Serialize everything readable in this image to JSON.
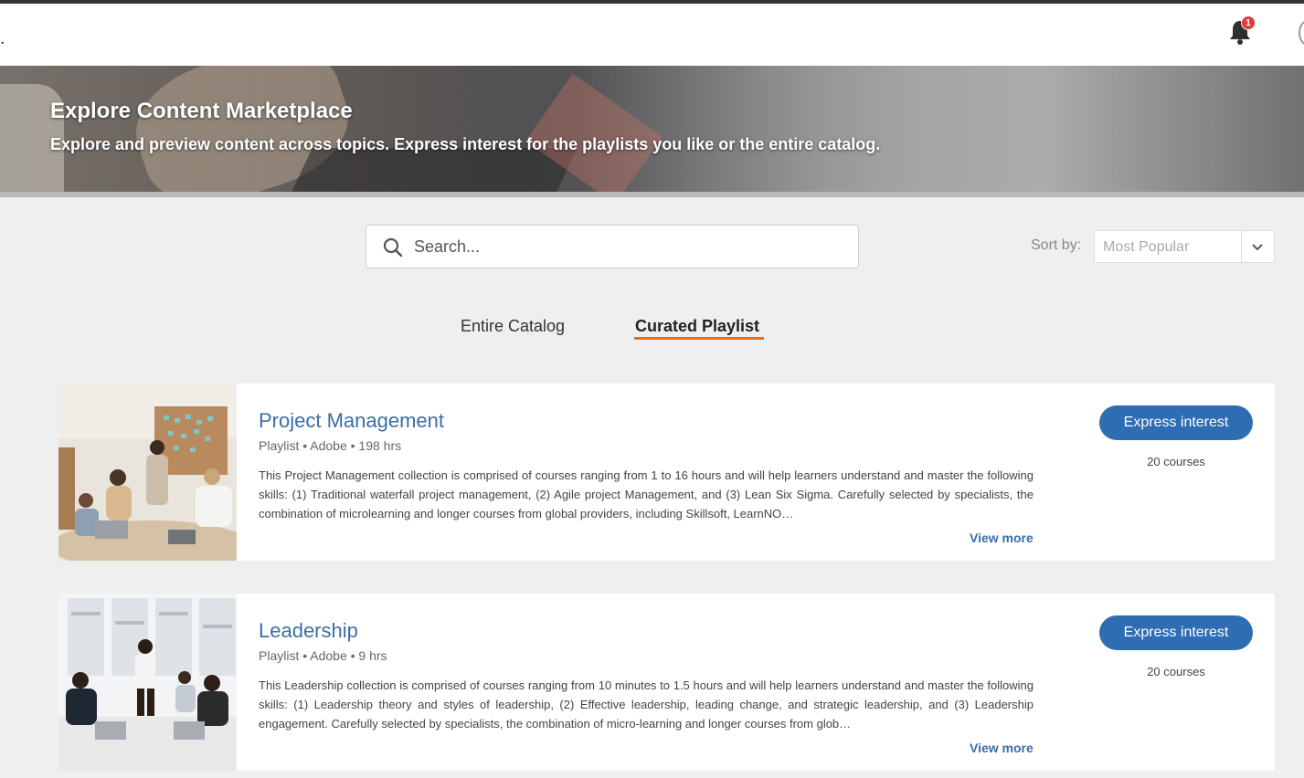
{
  "header": {
    "notification_count": "1",
    "leading_char": "."
  },
  "banner": {
    "title": "Explore Content Marketplace",
    "subtitle": "Explore and preview content across topics. Express interest for the playlists you like or the entire catalog."
  },
  "search": {
    "placeholder": "Search..."
  },
  "sort": {
    "label": "Sort by:",
    "value": "Most Popular"
  },
  "tabs": [
    {
      "label": "Entire Catalog",
      "active": false
    },
    {
      "label": "Curated Playlist",
      "active": true
    }
  ],
  "colors": {
    "accent_blue": "#2e6db4",
    "tab_underline": "#e86a1a",
    "badge": "#e53935"
  },
  "playlists": [
    {
      "title": "Project Management",
      "meta": "Playlist • Adobe • 198 hrs",
      "description": "This Project Management collection is comprised of courses ranging from 1 to 16 hours and will help learners understand and master the following skills: (1) Traditional waterfall project management, (2) Agile project Management, and (3) Lean Six Sigma. Carefully selected by specialists, the combination of microlearning and longer courses from global providers, including Skillsoft, LearnNO…",
      "view_more": "View more",
      "button": "Express interest",
      "courses": "20 courses"
    },
    {
      "title": "Leadership",
      "meta": "Playlist • Adobe • 9 hrs",
      "description": "This Leadership collection is comprised of courses ranging from 10 minutes to 1.5 hours and will help learners understand and master the following skills: (1) Leadership theory and styles of leadership, (2) Effective leadership, leading change, and strategic leadership, and (3) Leadership engagement. Carefully selected by specialists, the combination of micro-learning and longer courses from glob…",
      "view_more": "View more",
      "button": "Express interest",
      "courses": "20 courses"
    }
  ]
}
